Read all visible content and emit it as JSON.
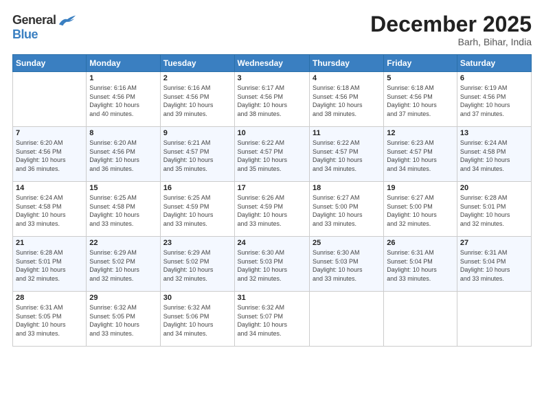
{
  "header": {
    "logo_general": "General",
    "logo_blue": "Blue",
    "month_title": "December 2025",
    "location": "Barh, Bihar, India"
  },
  "weekdays": [
    "Sunday",
    "Monday",
    "Tuesday",
    "Wednesday",
    "Thursday",
    "Friday",
    "Saturday"
  ],
  "rows": [
    [
      {
        "day": "",
        "info": ""
      },
      {
        "day": "1",
        "info": "Sunrise: 6:16 AM\nSunset: 4:56 PM\nDaylight: 10 hours\nand 40 minutes."
      },
      {
        "day": "2",
        "info": "Sunrise: 6:16 AM\nSunset: 4:56 PM\nDaylight: 10 hours\nand 39 minutes."
      },
      {
        "day": "3",
        "info": "Sunrise: 6:17 AM\nSunset: 4:56 PM\nDaylight: 10 hours\nand 38 minutes."
      },
      {
        "day": "4",
        "info": "Sunrise: 6:18 AM\nSunset: 4:56 PM\nDaylight: 10 hours\nand 38 minutes."
      },
      {
        "day": "5",
        "info": "Sunrise: 6:18 AM\nSunset: 4:56 PM\nDaylight: 10 hours\nand 37 minutes."
      },
      {
        "day": "6",
        "info": "Sunrise: 6:19 AM\nSunset: 4:56 PM\nDaylight: 10 hours\nand 37 minutes."
      }
    ],
    [
      {
        "day": "7",
        "info": "Sunrise: 6:20 AM\nSunset: 4:56 PM\nDaylight: 10 hours\nand 36 minutes."
      },
      {
        "day": "8",
        "info": "Sunrise: 6:20 AM\nSunset: 4:56 PM\nDaylight: 10 hours\nand 36 minutes."
      },
      {
        "day": "9",
        "info": "Sunrise: 6:21 AM\nSunset: 4:57 PM\nDaylight: 10 hours\nand 35 minutes."
      },
      {
        "day": "10",
        "info": "Sunrise: 6:22 AM\nSunset: 4:57 PM\nDaylight: 10 hours\nand 35 minutes."
      },
      {
        "day": "11",
        "info": "Sunrise: 6:22 AM\nSunset: 4:57 PM\nDaylight: 10 hours\nand 34 minutes."
      },
      {
        "day": "12",
        "info": "Sunrise: 6:23 AM\nSunset: 4:57 PM\nDaylight: 10 hours\nand 34 minutes."
      },
      {
        "day": "13",
        "info": "Sunrise: 6:24 AM\nSunset: 4:58 PM\nDaylight: 10 hours\nand 34 minutes."
      }
    ],
    [
      {
        "day": "14",
        "info": "Sunrise: 6:24 AM\nSunset: 4:58 PM\nDaylight: 10 hours\nand 33 minutes."
      },
      {
        "day": "15",
        "info": "Sunrise: 6:25 AM\nSunset: 4:58 PM\nDaylight: 10 hours\nand 33 minutes."
      },
      {
        "day": "16",
        "info": "Sunrise: 6:25 AM\nSunset: 4:59 PM\nDaylight: 10 hours\nand 33 minutes."
      },
      {
        "day": "17",
        "info": "Sunrise: 6:26 AM\nSunset: 4:59 PM\nDaylight: 10 hours\nand 33 minutes."
      },
      {
        "day": "18",
        "info": "Sunrise: 6:27 AM\nSunset: 5:00 PM\nDaylight: 10 hours\nand 33 minutes."
      },
      {
        "day": "19",
        "info": "Sunrise: 6:27 AM\nSunset: 5:00 PM\nDaylight: 10 hours\nand 32 minutes."
      },
      {
        "day": "20",
        "info": "Sunrise: 6:28 AM\nSunset: 5:01 PM\nDaylight: 10 hours\nand 32 minutes."
      }
    ],
    [
      {
        "day": "21",
        "info": "Sunrise: 6:28 AM\nSunset: 5:01 PM\nDaylight: 10 hours\nand 32 minutes."
      },
      {
        "day": "22",
        "info": "Sunrise: 6:29 AM\nSunset: 5:02 PM\nDaylight: 10 hours\nand 32 minutes."
      },
      {
        "day": "23",
        "info": "Sunrise: 6:29 AM\nSunset: 5:02 PM\nDaylight: 10 hours\nand 32 minutes."
      },
      {
        "day": "24",
        "info": "Sunrise: 6:30 AM\nSunset: 5:03 PM\nDaylight: 10 hours\nand 32 minutes."
      },
      {
        "day": "25",
        "info": "Sunrise: 6:30 AM\nSunset: 5:03 PM\nDaylight: 10 hours\nand 33 minutes."
      },
      {
        "day": "26",
        "info": "Sunrise: 6:31 AM\nSunset: 5:04 PM\nDaylight: 10 hours\nand 33 minutes."
      },
      {
        "day": "27",
        "info": "Sunrise: 6:31 AM\nSunset: 5:04 PM\nDaylight: 10 hours\nand 33 minutes."
      }
    ],
    [
      {
        "day": "28",
        "info": "Sunrise: 6:31 AM\nSunset: 5:05 PM\nDaylight: 10 hours\nand 33 minutes."
      },
      {
        "day": "29",
        "info": "Sunrise: 6:32 AM\nSunset: 5:05 PM\nDaylight: 10 hours\nand 33 minutes."
      },
      {
        "day": "30",
        "info": "Sunrise: 6:32 AM\nSunset: 5:06 PM\nDaylight: 10 hours\nand 34 minutes."
      },
      {
        "day": "31",
        "info": "Sunrise: 6:32 AM\nSunset: 5:07 PM\nDaylight: 10 hours\nand 34 minutes."
      },
      {
        "day": "",
        "info": ""
      },
      {
        "day": "",
        "info": ""
      },
      {
        "day": "",
        "info": ""
      }
    ]
  ]
}
